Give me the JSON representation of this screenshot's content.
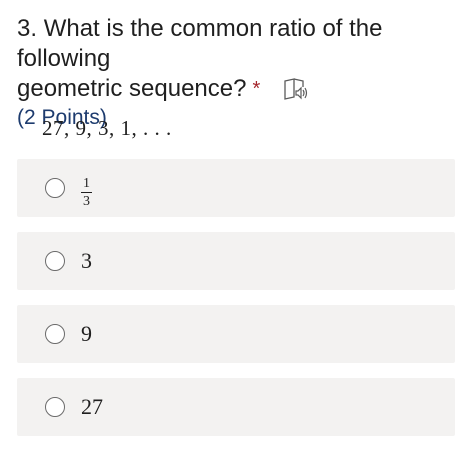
{
  "question": {
    "number": "3.",
    "text_line1": "What is the common ratio of the following",
    "text_line2": "geometric sequence?",
    "required_marker": "*",
    "points": "(2 Points)",
    "sequence": "27, 9, 3, 1, . . ."
  },
  "options": [
    {
      "numerator": "1",
      "denominator": "3"
    },
    {
      "label": "3"
    },
    {
      "label": "9"
    },
    {
      "label": "27"
    }
  ],
  "colors": {
    "option_background": "#f3f2f1",
    "required": "#a4262c",
    "points": "#1d3b6e"
  },
  "icons": {
    "speaker": "immersive-reader-icon",
    "radio": "radio-button-icon"
  }
}
